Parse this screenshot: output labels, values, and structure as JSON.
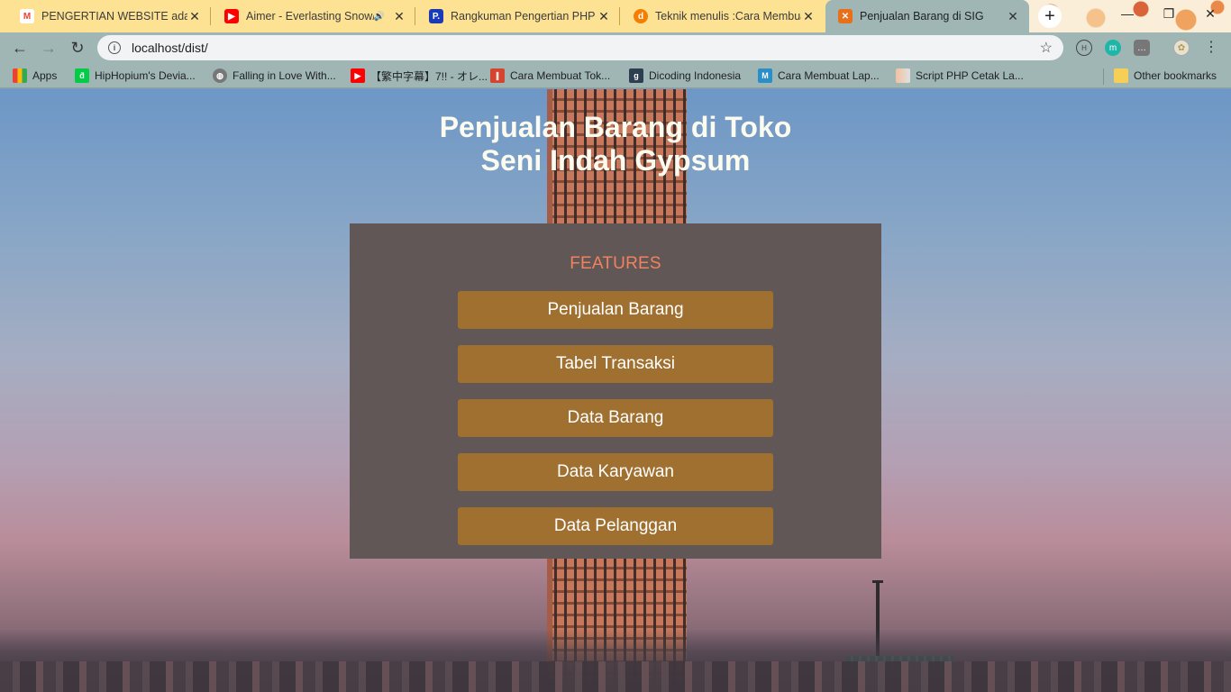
{
  "browser": {
    "tabs": [
      {
        "title": "PENGERTIAN WEBSITE adalah:",
        "favicon": "gmail-icon",
        "favicon_color": "#ea4335",
        "active": false
      },
      {
        "title": "Aimer - Everlasting Snow/L",
        "favicon": "youtube-icon",
        "favicon_color": "#ff0000",
        "active": false,
        "audio": true
      },
      {
        "title": "Rangkuman Pengertian PHP D",
        "favicon": "p-icon",
        "favicon_color": "#1a3bb8",
        "active": false
      },
      {
        "title": "Teknik menulis :Cara Membuat",
        "favicon": "blogger-icon",
        "favicon_color": "#f57d00",
        "active": false
      },
      {
        "title": "Penjualan Barang di SIG",
        "favicon": "xampp-icon",
        "favicon_color": "#e8701a",
        "active": true
      }
    ],
    "url": "localhost/dist/",
    "bookmarks": [
      {
        "label": "Apps",
        "icon": "apps-grid-icon"
      },
      {
        "label": "HipHopium's Devia...",
        "icon": "deviantart-icon"
      },
      {
        "label": "Falling in Love With...",
        "icon": "globe-icon"
      },
      {
        "label": "【繁中字幕】7!! - オレ...",
        "icon": "youtube-icon"
      },
      {
        "label": "Cara Membuat Tok...",
        "icon": "blogger-icon"
      },
      {
        "label": "Dicoding Indonesia",
        "icon": "dicoding-icon"
      },
      {
        "label": "Cara Membuat Lap...",
        "icon": "m-icon"
      },
      {
        "label": "Script PHP Cetak La...",
        "icon": "page-icon"
      },
      {
        "label": "Other bookmarks",
        "icon": "folder-icon"
      }
    ]
  },
  "page": {
    "title_line1": "Penjualan Barang di Toko",
    "title_line2": "Seni Indah Gypsum",
    "features_heading": "FEATURES",
    "features": [
      "Penjualan Barang",
      "Tabel Transaksi",
      "Data Barang",
      "Data Karyawan",
      "Data Pelanggan"
    ]
  },
  "colors": {
    "panel": "#615756",
    "button": "#a07030",
    "heading_accent": "#f0825e",
    "title_text": "#fbfbef"
  }
}
